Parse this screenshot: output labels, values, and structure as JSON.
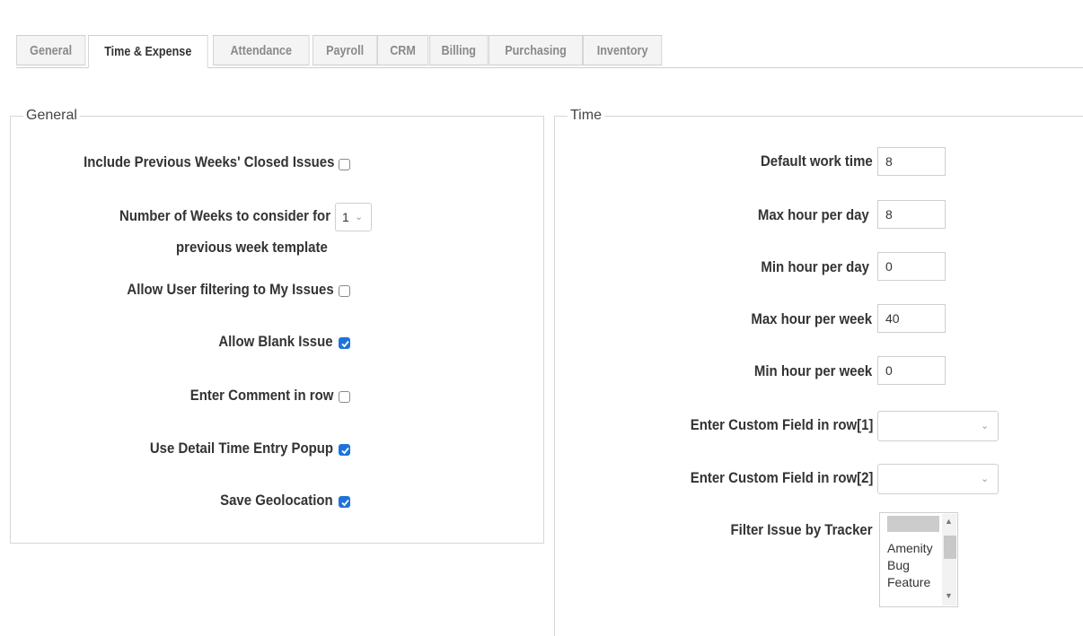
{
  "tabs": [
    {
      "label": "General",
      "active": false
    },
    {
      "label": "Time & Expense",
      "active": true
    },
    {
      "label": "Attendance",
      "active": false
    },
    {
      "label": "Payroll",
      "active": false
    },
    {
      "label": "CRM",
      "active": false
    },
    {
      "label": "Billing",
      "active": false
    },
    {
      "label": "Purchasing",
      "active": false
    },
    {
      "label": "Inventory",
      "active": false
    }
  ],
  "general": {
    "legend": "General",
    "include_prev_label": "Include Previous Weeks' Closed Issues",
    "include_prev_checked": false,
    "num_weeks_label_1": "Number of Weeks to consider for",
    "num_weeks_label_2": "previous week template",
    "num_weeks_value": "1",
    "allow_filter_label": "Allow User filtering to My Issues",
    "allow_filter_checked": false,
    "allow_blank_label": "Allow Blank Issue",
    "allow_blank_checked": true,
    "comment_row_label": "Enter Comment in row",
    "comment_row_checked": false,
    "detail_popup_label": "Use Detail Time Entry Popup",
    "detail_popup_checked": true,
    "geolocation_label": "Save Geolocation",
    "geolocation_checked": true
  },
  "time": {
    "legend": "Time",
    "default_work_label": "Default work time",
    "default_work_value": "8",
    "max_day_label": "Max hour per day",
    "max_day_value": "8",
    "min_day_label": "Min hour per day",
    "min_day_value": "0",
    "max_week_label": "Max hour per week",
    "max_week_value": "40",
    "min_week_label": "Min hour per week",
    "min_week_value": "0",
    "custom1_label": "Enter Custom Field in row[1]",
    "custom1_value": "",
    "custom2_label": "Enter Custom Field in row[2]",
    "custom2_value": "",
    "tracker_label": "Filter Issue by Tracker",
    "tracker_options": [
      "",
      "Amenity",
      "Bug",
      "Feature"
    ]
  },
  "colors": {
    "accent": "#1e73d8"
  }
}
